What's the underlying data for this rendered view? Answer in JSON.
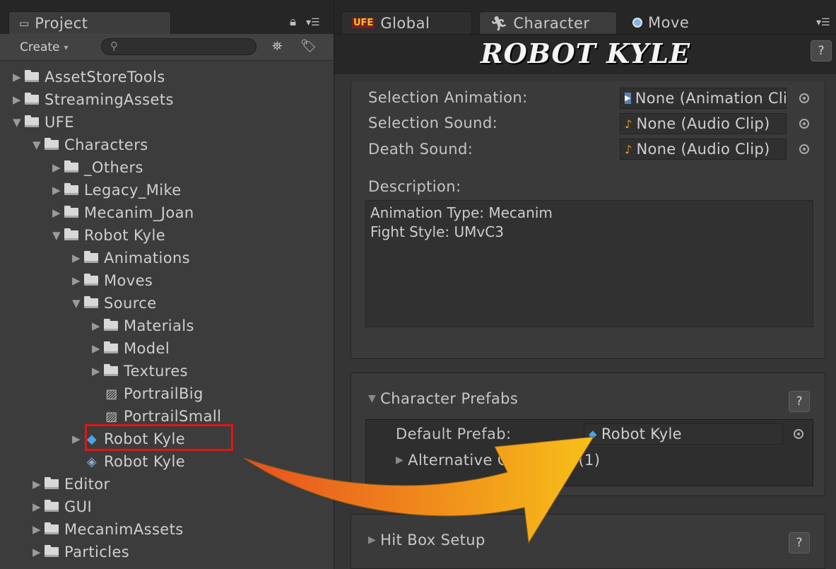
{
  "project_panel": {
    "tab_label": "Project",
    "create_label": "Create",
    "create_arrow": "▾",
    "search_placeholder": "",
    "tree": [
      {
        "label": "AssetStoreTools",
        "type": "folder",
        "depth": 0,
        "expanded": false
      },
      {
        "label": "StreamingAssets",
        "type": "folder",
        "depth": 0,
        "expanded": false
      },
      {
        "label": "UFE",
        "type": "folder",
        "depth": 0,
        "expanded": true
      },
      {
        "label": "Characters",
        "type": "folder",
        "depth": 1,
        "expanded": true
      },
      {
        "label": "_Others",
        "type": "folder",
        "depth": 2,
        "expanded": false
      },
      {
        "label": "Legacy_Mike",
        "type": "folder",
        "depth": 2,
        "expanded": false
      },
      {
        "label": "Mecanim_Joan",
        "type": "folder",
        "depth": 2,
        "expanded": false
      },
      {
        "label": "Robot Kyle",
        "type": "folder",
        "depth": 2,
        "expanded": true
      },
      {
        "label": "Animations",
        "type": "folder",
        "depth": 3,
        "expanded": false
      },
      {
        "label": "Moves",
        "type": "folder",
        "depth": 3,
        "expanded": false
      },
      {
        "label": "Source",
        "type": "folder",
        "depth": 3,
        "expanded": true
      },
      {
        "label": "Materials",
        "type": "folder",
        "depth": 4,
        "expanded": false
      },
      {
        "label": "Model",
        "type": "folder",
        "depth": 4,
        "expanded": false
      },
      {
        "label": "Textures",
        "type": "folder",
        "depth": 4,
        "expanded": false
      },
      {
        "label": "PortrailBig",
        "type": "texture",
        "depth": 4
      },
      {
        "label": "PortrailSmall",
        "type": "texture",
        "depth": 4
      },
      {
        "label": "Robot Kyle",
        "type": "prefab",
        "depth": 3,
        "highlighted": true
      },
      {
        "label": "Robot Kyle",
        "type": "scriptable-object",
        "depth": 3
      },
      {
        "label": "Editor",
        "type": "folder",
        "depth": 1,
        "expanded": false
      },
      {
        "label": "GUI",
        "type": "folder",
        "depth": 1,
        "expanded": false
      },
      {
        "label": "MecanimAssets",
        "type": "folder",
        "depth": 1,
        "expanded": false
      },
      {
        "label": "Particles",
        "type": "folder",
        "depth": 1,
        "expanded": false
      }
    ]
  },
  "inspector": {
    "tabs": [
      {
        "label": "Global",
        "icon": "ufe-icon",
        "icon_text": "UFE"
      },
      {
        "label": "Character",
        "icon": "runner-icon",
        "active": true
      },
      {
        "label": "Move",
        "icon": "move-icon"
      }
    ],
    "title": "ROBOT KYLE",
    "help_label": "?",
    "fields": {
      "selection_animation": {
        "label": "Selection Animation:",
        "value": "None (Animation Clip)"
      },
      "selection_sound": {
        "label": "Selection Sound:",
        "value": "None (Audio Clip)"
      },
      "death_sound": {
        "label": "Death Sound:",
        "value": "None (Audio Clip)"
      }
    },
    "description": {
      "label": "Description:",
      "line1": "Animation Type: Mecanim",
      "line2": "Fight Style: UMvC3"
    },
    "character_prefabs": {
      "title": "Character Prefabs",
      "default_prefab_label": "Default Prefab:",
      "default_prefab_value": "Robot Kyle",
      "alternative_costumes": "Alternative Costumes (1)"
    },
    "hit_box_setup": {
      "title": "Hit Box Setup"
    }
  },
  "colors": {
    "highlight": "#e21414",
    "arrow_start": "#e8501e",
    "arrow_end": "#f7c019"
  }
}
